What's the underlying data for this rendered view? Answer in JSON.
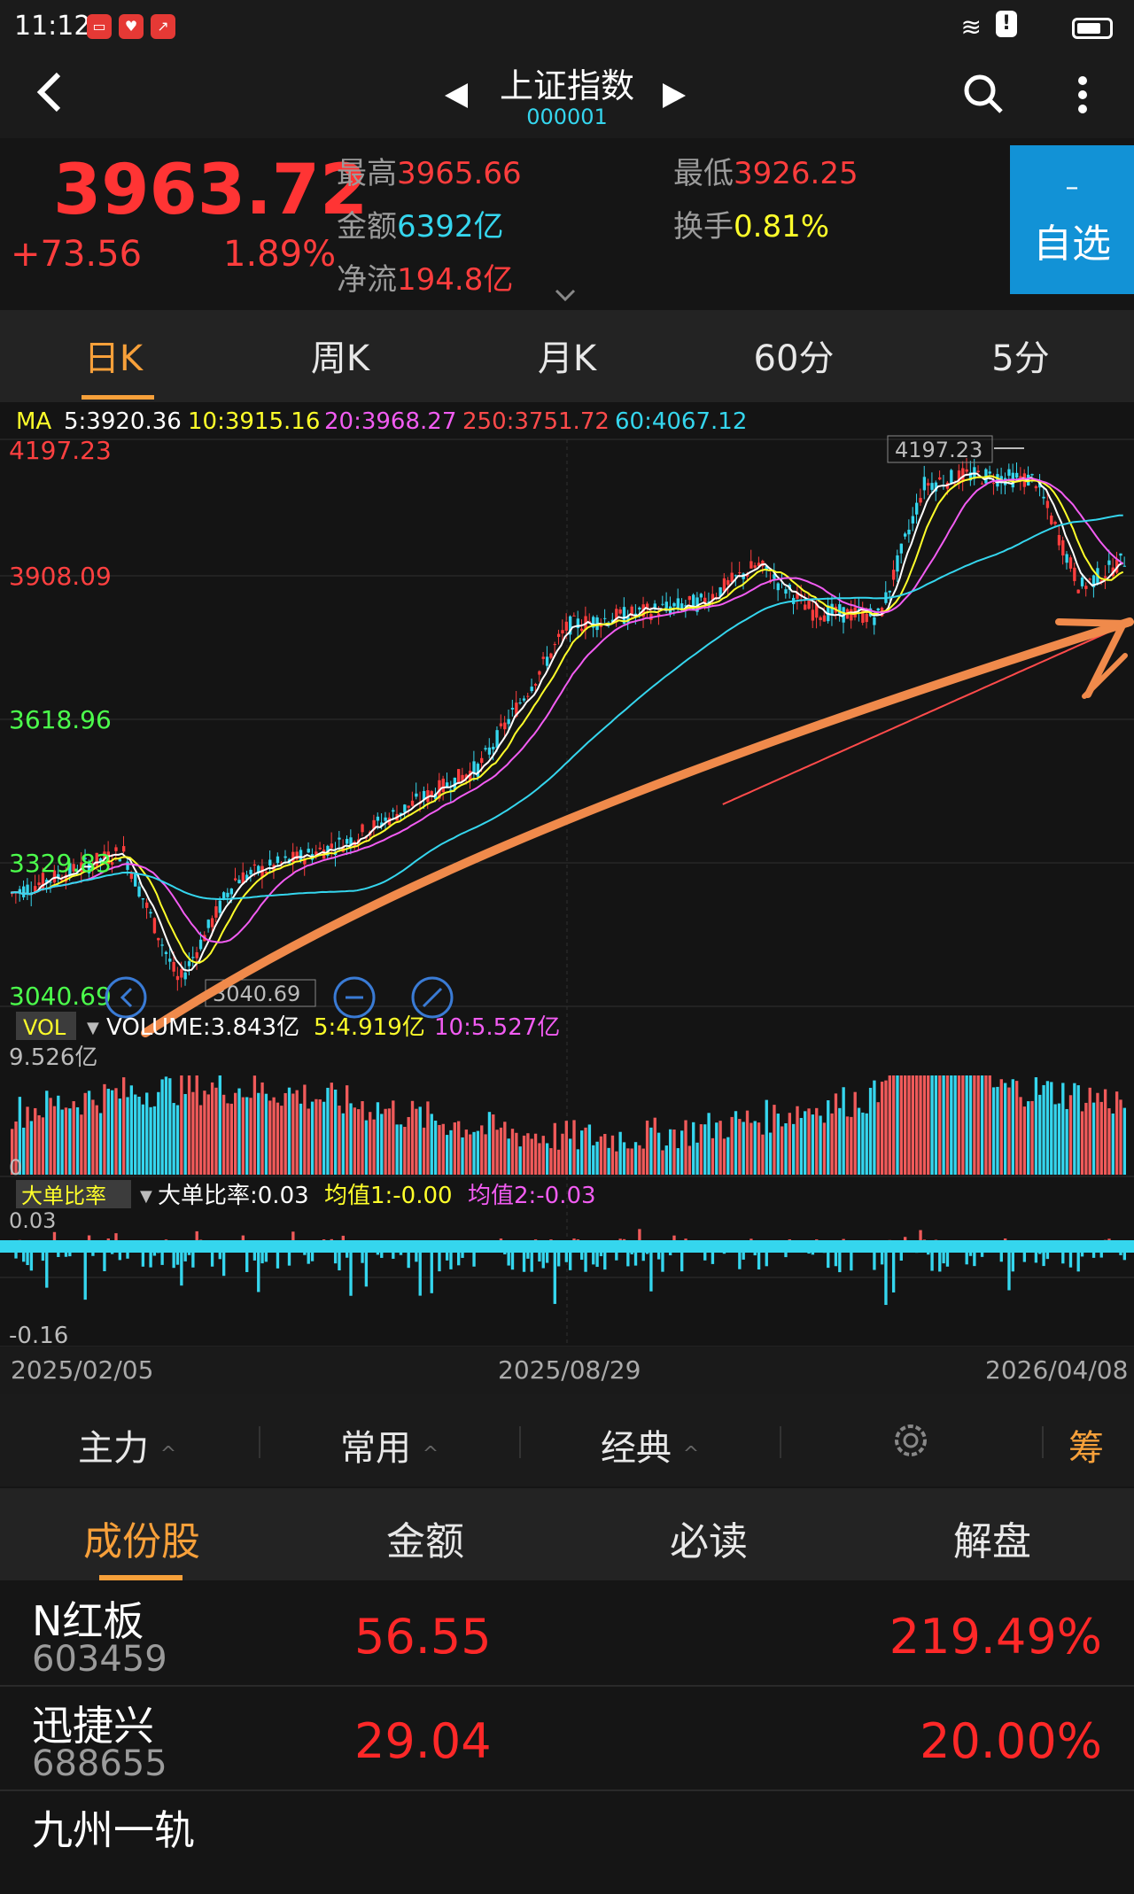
{
  "status": {
    "time": "11:12"
  },
  "header": {
    "title": "上证指数",
    "code": "000001"
  },
  "quote": {
    "price": "3963.72",
    "change": "+73.56",
    "change_pct": "1.89%",
    "high_label": "最高",
    "high": "3965.66",
    "low_label": "最低",
    "low": "3926.25",
    "amount_label": "金额",
    "amount": "6392亿",
    "turnover_label": "换手",
    "turnover": "0.81%",
    "netflow_label": "净流",
    "netflow": "194.8亿",
    "fav_sign": "–",
    "fav_label": "自选"
  },
  "ktabs": [
    "日K",
    "周K",
    "月K",
    "60分",
    "5分"
  ],
  "ma_legend": {
    "ma": "MA",
    "ma5": "5:3920.36",
    "ma10": "10:3915.16",
    "ma20": "20:3968.27",
    "ma250": "250:3751.72",
    "ma60": "60:4067.12"
  },
  "price_axis": [
    "4197.23",
    "3908.09",
    "3618.96",
    "3329.83",
    "3040.69"
  ],
  "price_markers": {
    "high": "4197.23",
    "low": "3040.69"
  },
  "volume": {
    "tag": "VOL",
    "legend": "VOLUME:3.843亿",
    "ma5": "5:4.919亿",
    "ma10": "10:5.527亿",
    "max": "9.526亿",
    "zero": "0"
  },
  "bigorder": {
    "tag": "大单比率",
    "legend": "大单比率:0.03",
    "avg1": "均值1:-0.00",
    "avg2": "均值2:-0.03",
    "max": "0.03",
    "min": "-0.16"
  },
  "dates": [
    "2025/02/05",
    "2025/08/29",
    "2026/04/08"
  ],
  "toolbar": {
    "t1": "主力",
    "t2": "常用",
    "t3": "经典",
    "chip": "筹"
  },
  "list_tabs": [
    "成份股",
    "金额",
    "必读",
    "解盘"
  ],
  "stocks": [
    {
      "name": "N红板",
      "code": "603459",
      "price": "56.55",
      "pct": "219.49%"
    },
    {
      "name": "迅捷兴",
      "code": "688655",
      "price": "29.04",
      "pct": "20.00%"
    },
    {
      "name": "九州一轨",
      "code": "",
      "price": "",
      "pct": ""
    }
  ],
  "colors": {
    "up": "#ff3d3d",
    "down": "#35d6ee",
    "accent": "#f7a03a",
    "fav_bg": "#1292d6"
  },
  "chart_data": {
    "type": "line",
    "title": "",
    "x": [
      "2025/02/05",
      "2025/08/29",
      "2026/04/08"
    ],
    "series": [
      {
        "name": "MA5",
        "values": [
          3920.36
        ]
      },
      {
        "name": "MA10",
        "values": [
          3915.16
        ]
      },
      {
        "name": "MA20",
        "values": [
          3968.27
        ]
      },
      {
        "name": "MA250",
        "values": [
          3751.72
        ]
      },
      {
        "name": "MA60",
        "values": [
          4067.12
        ]
      }
    ],
    "ylim": [
      3040.69,
      4197.23
    ],
    "grid": true
  }
}
